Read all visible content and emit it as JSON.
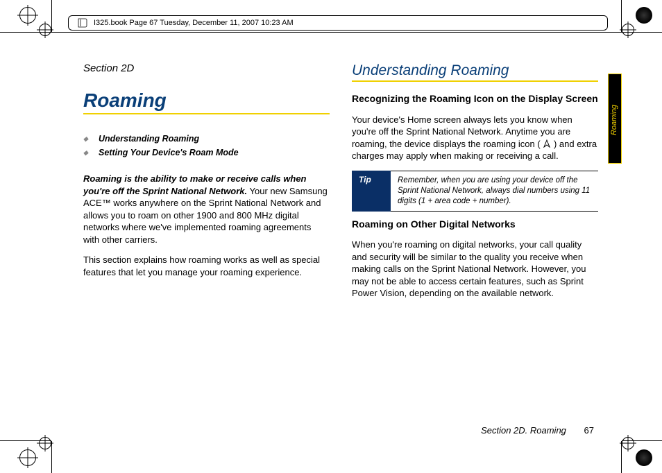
{
  "header": {
    "book_info": "I325.book  Page 67  Tuesday, December 11, 2007  10:23 AM"
  },
  "left": {
    "section_label": "Section 2D",
    "title": "Roaming",
    "toc": [
      "Understanding Roaming",
      "Setting Your Device's Roam Mode"
    ],
    "lead_bold": "Roaming is the ability to make or receive calls when you're off the Sprint National Network.",
    "lead_rest": " Your new Samsung ACE™ works anywhere on the Sprint National Network and allows you to roam on other 1900 and 800 MHz digital networks where we've implemented roaming agreements with other carriers.",
    "p2": "This section explains how roaming works as well as special features that let you manage your roaming experience."
  },
  "right": {
    "h2": "Understanding Roaming",
    "sub1": "Recognizing the Roaming Icon on the Display Screen",
    "p1a": "Your device's Home screen always lets you know when you're off the Sprint National Network. Anytime you are roaming, the device displays the roaming icon (",
    "p1b": ") and extra charges may apply when making or receiving a call.",
    "tip_label": "Tip",
    "tip_text": "Remember, when you are using your device off the Sprint National Network, always dial numbers using 11 digits (1 + area code + number).",
    "sub2": "Roaming on Other Digital Networks",
    "p2": "When you're roaming on digital networks, your call quality and security will be similar to the quality you receive when making calls on the Sprint National Network. However, you may not be able to access certain features, such as Sprint Power Vision, depending on the available network."
  },
  "sidetab": "Roaming",
  "footer": {
    "section": "Section 2D. Roaming",
    "page": "67"
  }
}
